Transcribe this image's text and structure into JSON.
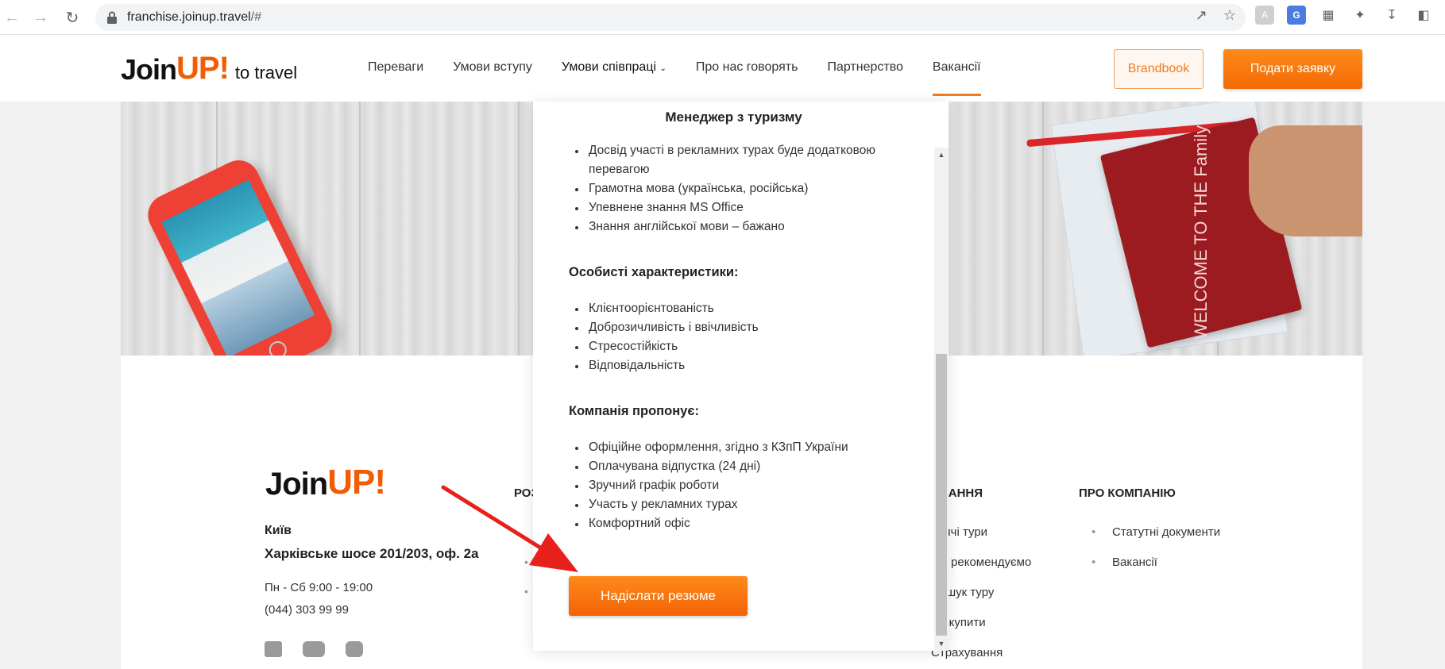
{
  "browser": {
    "url_host": "franchise.joinup.travel",
    "url_tail": "/#"
  },
  "header": {
    "logo_join": "Join",
    "logo_up": "UP!",
    "logo_tagline": "to travel",
    "menu": [
      {
        "label": "Переваги"
      },
      {
        "label": "Умови вступу"
      },
      {
        "label": "Умови співпраці"
      },
      {
        "label": "Про нас говорять"
      },
      {
        "label": "Партнерство"
      },
      {
        "label": "Вакансії"
      }
    ],
    "brandbook_label": "Brandbook",
    "apply_label": "Подати заявку"
  },
  "hero": {
    "card_text": "WELCOME TO THE Family"
  },
  "modal": {
    "title": "Менеджер з туризму",
    "requirements_partial": "Досвід участі в рекламних турах буде додатковою перевагою",
    "requirements": [
      "Грамотна мова (українська, російська)",
      "Упевнене знання MS Office",
      "Знання англійської мови – бажано"
    ],
    "personal_heading": "Особисті характеристики:",
    "personal": [
      "Клієнтоорієнтованість",
      "Доброзичливість і ввічливість",
      "Стресостійкість",
      "Відповідальність"
    ],
    "offer_heading": "Компанія пропонує:",
    "offer": [
      "Офіційне оформлення, згідно з КЗпП України",
      "Оплачувана відпустка (24 дні)",
      "Зручний графік роботи",
      "Участь у рекламних турах",
      "Комфортний офіс"
    ],
    "send_label": "Надіслати резюме"
  },
  "footer": {
    "logo_join": "Join",
    "logo_up": "UP!",
    "city": "Київ",
    "address": "Харківське шосе 201/203, оф. 2а",
    "hours": "Пн - Сб 9:00 - 19:00",
    "phone": "(044) 303 99 99",
    "col_partial_heading": "РОЗ",
    "col_rozd_heading": "ОВАННЯ",
    "col_rozd_items": [
      "арячі тури",
      "Ми рекомендуємо",
      "Пошук туру",
      "Де купити",
      "Страхування"
    ],
    "col_about_heading": "ПРО КОМПАНІЮ",
    "col_about_items": [
      "Статутні документи",
      "Вакансії"
    ]
  },
  "colors": {
    "accent": "#f27b1f",
    "arrow": "#e8201b"
  }
}
